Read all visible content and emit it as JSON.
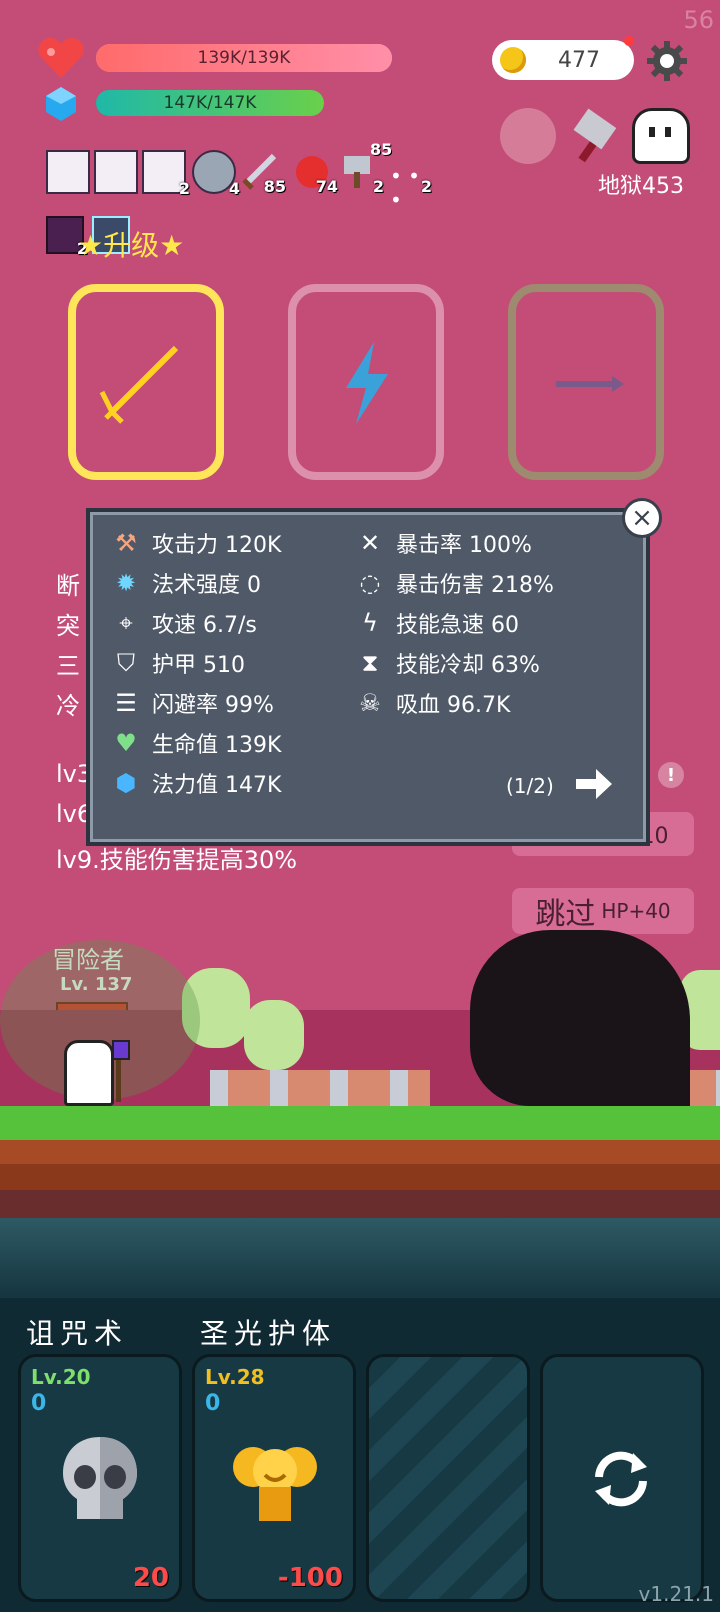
{
  "fps": "56",
  "hud": {
    "hp_text": "139K/139K",
    "mana_text": "147K/147K",
    "gold": "477",
    "stage_label": "地狱453"
  },
  "buffs": [
    {
      "name": "scroll-buff-1",
      "count": ""
    },
    {
      "name": "scroll-buff-2",
      "count": ""
    },
    {
      "name": "scroll-buff-3",
      "count": "2"
    },
    {
      "name": "drum-buff",
      "count": "4"
    },
    {
      "name": "sword-buff",
      "count": "85"
    },
    {
      "name": "apple-buff",
      "count": "74"
    },
    {
      "name": "hammer-buff",
      "count": "2"
    },
    {
      "name": "dots-buff",
      "count": "2"
    }
  ],
  "hammer_top_count": "85",
  "buff_row2_count": "2",
  "upgrade_title": "★升级★",
  "stats_panel": {
    "left": [
      {
        "icon": "axe-icon",
        "label": "攻击力 120K"
      },
      {
        "icon": "sun-icon",
        "label": "法术强度 0"
      },
      {
        "icon": "crosshair-icon",
        "label": "攻速 6.7/s"
      },
      {
        "icon": "shield-icon",
        "label": "护甲 510"
      },
      {
        "icon": "dodge-icon",
        "label": "闪避率 99%"
      },
      {
        "icon": "heart-icon",
        "label": "生命值 139K"
      },
      {
        "icon": "mana-icon",
        "label": "法力值 147K"
      }
    ],
    "right": [
      {
        "icon": "crit-icon",
        "label": "暴击率 100%"
      },
      {
        "icon": "crit-dmg-icon",
        "label": "暴击伤害 218%"
      },
      {
        "icon": "lightning-icon",
        "label": "技能急速 60"
      },
      {
        "icon": "hourglass-icon",
        "label": "技能冷却 63%"
      },
      {
        "icon": "lifesteal-icon",
        "label": "吸血 96.7K"
      }
    ],
    "page": "(1/2)"
  },
  "left_text": [
    "断",
    "突",
    "三",
    "冷",
    "lv3",
    "lv6",
    "lv9.技能伤害提高30%"
  ],
  "buttons": {
    "refresh_partial": "刷新 金币-10",
    "skip_label": "跳过",
    "skip_bonus": "HP+40"
  },
  "hero": {
    "name": "冒险者",
    "level": "Lv. 137"
  },
  "skills": [
    {
      "title": "诅咒术",
      "level": "Lv.20",
      "mana": "0",
      "cost": "20",
      "level_color": "#7ee06a"
    },
    {
      "title": "圣光护体",
      "level": "Lv.28",
      "mana": "0",
      "cost": "-100",
      "level_color": "#f0c020"
    }
  ],
  "version": "v1.21.1"
}
